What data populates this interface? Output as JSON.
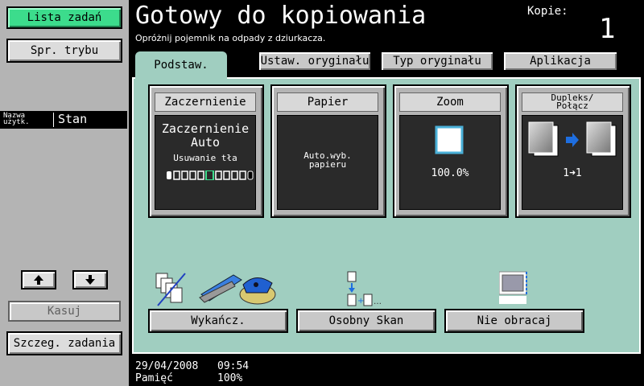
{
  "left_panel": {
    "job_list_label": "Lista zadań",
    "mode_check_label": "Spr. trybu",
    "user_col_label_line1": "Nazwa",
    "user_col_label_line2": "użytk.",
    "status_col_label": "Stan",
    "delete_label": "Kasuj",
    "job_details_label": "Szczeg. zadania"
  },
  "header": {
    "title": "Gotowy do kopiowania",
    "subtitle": "Opróżnij pojemnik na odpady z dziurkacza.",
    "copies_label": "Kopie:",
    "copies_value": "1"
  },
  "tabs": [
    {
      "label": "Podstaw."
    },
    {
      "label": "Ustaw. oryginału"
    },
    {
      "label": "Typ oryginału"
    },
    {
      "label": "Aplikacja"
    }
  ],
  "cards": {
    "density": {
      "title": "Zaczernienie",
      "line1": "Zaczernienie",
      "line2": "Auto",
      "line3": "Usuwanie tła"
    },
    "paper": {
      "title": "Papier",
      "line1": "Auto.wyb.",
      "line2": "papieru"
    },
    "zoom": {
      "title": "Zoom",
      "value": "100.0%"
    },
    "duplex": {
      "title_line1": "Dupleks/",
      "title_line2": "Połącz",
      "mode": "1➜1"
    }
  },
  "bottom_buttons": {
    "finishing": "Wykańcz.",
    "separate_scan": "Osobny Skan",
    "no_rotate": "Nie obracaj"
  },
  "footer": {
    "date": "29/04/2008",
    "time": "09:54",
    "memory_label": "Pamięć",
    "memory_value": "100%"
  },
  "colors": {
    "accent_green": "#3cdc8c",
    "panel_teal": "#a0cec0"
  }
}
